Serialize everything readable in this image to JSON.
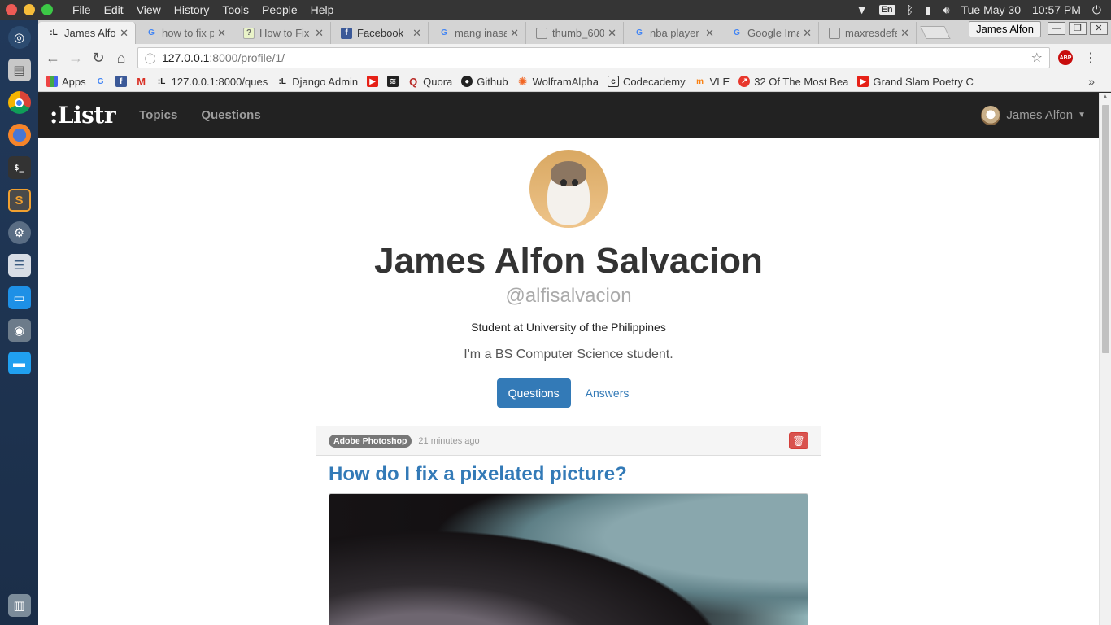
{
  "os": {
    "menu": [
      "File",
      "Edit",
      "View",
      "History",
      "Tools",
      "People",
      "Help"
    ],
    "status": {
      "language": "En",
      "clock": "Tue May 30",
      "time": "10:57 PM"
    }
  },
  "dock": {
    "icons": [
      "ubuntu-icon",
      "files-icon",
      "chrome-icon",
      "firefox-icon",
      "terminal-icon",
      "sublime-icon",
      "settings-icon",
      "system-icon",
      "windows-icon",
      "disks-icon",
      "folder-icon",
      "trash-icon"
    ]
  },
  "browser": {
    "tabs": [
      {
        "title": "James Alfon Salvacion",
        "icon": "listr-icon",
        "active": true
      },
      {
        "title": "how to fix pixelated",
        "icon": "google-icon"
      },
      {
        "title": "How to Fix a Pixelated",
        "icon": "question-icon"
      },
      {
        "title": "Facebook",
        "icon": "facebook-icon"
      },
      {
        "title": "mang inasal",
        "icon": "google-icon"
      },
      {
        "title": "thumb_600",
        "icon": "page-icon"
      },
      {
        "title": "nba player",
        "icon": "google-icon"
      },
      {
        "title": "Google Images",
        "icon": "google-icon"
      },
      {
        "title": "maxresdefault",
        "icon": "page-icon"
      }
    ],
    "profile_name": "James Alfon",
    "url_host": "127.0.0.1",
    "url_path": ":8000/profile/1/",
    "abp": "ABP",
    "bookmarks": [
      {
        "label": "Apps",
        "icon": "apps-icon"
      },
      {
        "label": "",
        "icon": "google-icon"
      },
      {
        "label": "",
        "icon": "facebook-icon"
      },
      {
        "label": "",
        "icon": "gmail-icon"
      },
      {
        "label": "127.0.0.1:8000/ques",
        "icon": "listr-icon"
      },
      {
        "label": "Django Admin",
        "icon": "listr-icon"
      },
      {
        "label": "",
        "icon": "youtube-icon"
      },
      {
        "label": "",
        "icon": "steem-icon"
      },
      {
        "label": "Quora",
        "icon": "quora-icon"
      },
      {
        "label": "Github",
        "icon": "github-icon"
      },
      {
        "label": "WolframAlpha",
        "icon": "wolfram-icon"
      },
      {
        "label": "Codecademy",
        "icon": "codecademy-icon"
      },
      {
        "label": "VLE",
        "icon": "moodle-icon"
      },
      {
        "label": "32 Of The Most Bea",
        "icon": "trending-icon"
      },
      {
        "label": "Grand Slam Poetry C",
        "icon": "youtube-icon"
      }
    ]
  },
  "site": {
    "brand": ":Listr",
    "nav": [
      "Topics",
      "Questions"
    ],
    "user_menu": "James Alfon"
  },
  "profile": {
    "name": "James Alfon Salvacion",
    "handle": "@alfisalvacion",
    "tagline": "Student at University of the Philippines",
    "bio": "I'm a BS Computer Science student.",
    "tabs": [
      {
        "label": "Questions",
        "active": true
      },
      {
        "label": "Answers",
        "active": false
      }
    ]
  },
  "question": {
    "topic": "Adobe Photoshop",
    "time": "21 minutes ago",
    "title": "How do I fix a pixelated picture?"
  },
  "colors": {
    "primary": "#337ab7",
    "danger": "#d9534f",
    "navbar": "#222222"
  }
}
